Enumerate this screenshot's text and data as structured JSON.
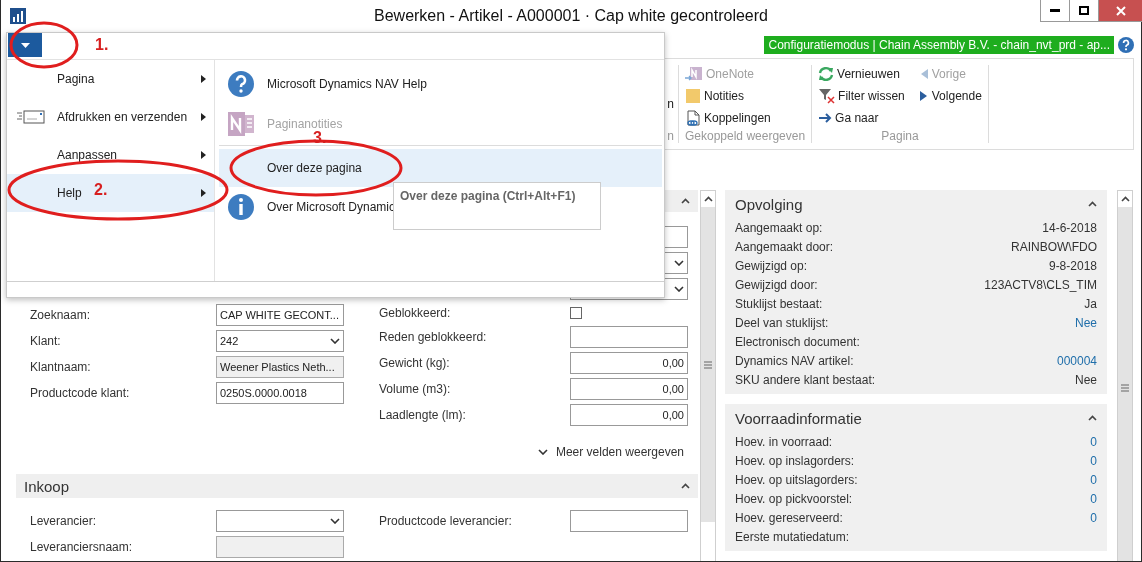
{
  "window": {
    "title": "Bewerken - Artikel - A000001 · Cap white gecontroleerd"
  },
  "banner": "Configuratiemodus | Chain Assembly B.V. - chain_nvt_prd - ap...",
  "ribbon": {
    "cut_item": "n",
    "cut_group_label": "n",
    "groups": [
      {
        "label": "Gekoppeld weergeven",
        "columns": [
          [
            {
              "label": "OneNote",
              "disabled": true
            },
            {
              "label": "Notities",
              "disabled": false
            },
            {
              "label": "Koppelingen",
              "disabled": false
            }
          ]
        ]
      },
      {
        "label": "Pagina",
        "columns": [
          [
            {
              "label": "Vernieuwen",
              "disabled": false
            },
            {
              "label": "Filter wissen",
              "disabled": false
            },
            {
              "label": "Ga naar",
              "disabled": false
            }
          ],
          [
            {
              "label": "Vorige",
              "disabled": true
            },
            {
              "label": "Volgende",
              "disabled": false
            }
          ]
        ]
      }
    ]
  },
  "general": {
    "left_rows": [
      {
        "label": "Zoeknaam:",
        "kind": "input",
        "value": "CAP WHITE GECONT..."
      },
      {
        "label": "Klant:",
        "kind": "select",
        "value": "242"
      },
      {
        "label": "Klantnaam:",
        "kind": "readonly",
        "value": "Weener Plastics Neth..."
      },
      {
        "label": "Productcode klant:",
        "kind": "input",
        "value": "0250S.0000.0018"
      }
    ],
    "right_cut_fields": [
      {
        "kind": "input"
      },
      {
        "kind": "select"
      },
      {
        "kind": "select"
      }
    ],
    "right_rows": [
      {
        "label": "Geblokkeerd:",
        "kind": "checkbox",
        "checked": false
      },
      {
        "label": "Reden geblokkeerd:",
        "kind": "input"
      },
      {
        "label": "Gewicht (kg):",
        "kind": "number",
        "value": "0,00"
      },
      {
        "label": "Volume (m3):",
        "kind": "number",
        "value": "0,00"
      },
      {
        "label": "Laadlengte (lm):",
        "kind": "number",
        "value": "0,00"
      }
    ],
    "more_fields": "Meer velden weergeven"
  },
  "purchase": {
    "title": "Inkoop",
    "left_rows": [
      {
        "label": "Leverancier:",
        "kind": "select"
      },
      {
        "label": "Leveranciersnaam:",
        "kind": "readonly"
      }
    ],
    "right_rows": [
      {
        "label": "Productcode leverancier:",
        "kind": "input"
      }
    ]
  },
  "factboxes": [
    {
      "title": "Opvolging",
      "rows": [
        {
          "label": "Aangemaakt op:",
          "value": "14-6-2018",
          "link": false
        },
        {
          "label": "Aangemaakt door:",
          "value": "RAINBOW\\FDO",
          "link": false
        },
        {
          "label": "Gewijzigd op:",
          "value": "9-8-2018",
          "link": false
        },
        {
          "label": "Gewijzigd door:",
          "value": "123ACTV8\\CLS_TIM",
          "link": false
        },
        {
          "label": "Stuklijst bestaat:",
          "value": "Ja",
          "link": false
        },
        {
          "label": "Deel van stuklijst:",
          "value": "Nee",
          "link": true
        },
        {
          "label": "Electronisch document:"
        },
        {
          "label": "Dynamics NAV artikel:",
          "value": "000004",
          "link": true
        },
        {
          "label": "SKU andere klant bestaat:",
          "value": "Nee",
          "link": false
        }
      ]
    },
    {
      "title": "Voorraadinformatie",
      "rows": [
        {
          "label": "Hoev. in voorraad:",
          "value": "0",
          "link": true
        },
        {
          "label": "Hoev. op inslagorders:",
          "value": "0",
          "link": true
        },
        {
          "label": "Hoev. op uitslagorders:",
          "value": "0",
          "link": true
        },
        {
          "label": "Hoev. op pickvoorstel:",
          "value": "0",
          "link": true
        },
        {
          "label": "Hoev. gereserveerd:",
          "value": "0",
          "link": true
        },
        {
          "label": "Eerste mutatiedatum:"
        }
      ]
    }
  ],
  "menu": {
    "items": [
      {
        "label": "Pagina",
        "selected": false
      },
      {
        "label": "Afdrukken en verzenden",
        "selected": false
      },
      {
        "label": "Aanpassen",
        "selected": false
      },
      {
        "label": "Help",
        "selected": true
      }
    ],
    "submenu": [
      {
        "label": "Microsoft Dynamics NAV Help",
        "disabled": false,
        "selected": false
      },
      {
        "label": "Paginanotities",
        "disabled": true,
        "selected": false
      },
      {
        "label": "Over deze pagina",
        "disabled": false,
        "selected": true
      },
      {
        "label": "Over Microsoft Dynamic",
        "disabled": false,
        "selected": false
      }
    ],
    "tooltip": "Over deze pagina (Ctrl+Alt+F1)"
  },
  "annotations": [
    "1.",
    "2.",
    "3."
  ]
}
